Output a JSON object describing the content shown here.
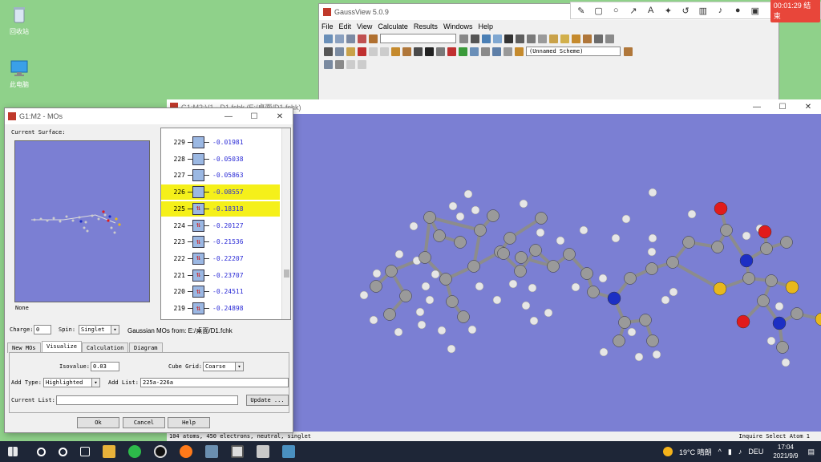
{
  "desktop": {
    "icons": [
      {
        "name": "recycle-bin",
        "label": "回收站"
      },
      {
        "name": "this-pc",
        "label": "此电脑"
      }
    ]
  },
  "recorder": {
    "timer": "00:01:29 结束"
  },
  "gaussview": {
    "title": "GaussView 5.0.9",
    "menu": [
      "File",
      "Edit",
      "View",
      "Calculate",
      "Results",
      "Windows",
      "Help"
    ],
    "scheme": "(Unnamed Scheme)"
  },
  "molecule_window": {
    "title": "G1:M2:V1 - D1.fchk (E:/桌面/D1.fchk)",
    "status_left": "104 atoms, 450 electrons, neutral, singlet",
    "status_right": "Inquire Select Atom 1"
  },
  "mos_dialog": {
    "title": "G1:M2 - MOs",
    "current_surface_label": "Current Surface:",
    "none_label": "None",
    "orbitals": [
      {
        "num": "229",
        "value": "-0.01981",
        "occupied": false,
        "highlight": false
      },
      {
        "num": "228",
        "value": "-0.05038",
        "occupied": false,
        "highlight": false
      },
      {
        "num": "227",
        "value": "-0.05863",
        "occupied": false,
        "highlight": false
      },
      {
        "num": "226",
        "value": "-0.08557",
        "occupied": false,
        "highlight": true
      },
      {
        "num": "225",
        "value": "-0.18318",
        "occupied": true,
        "highlight": true
      },
      {
        "num": "224",
        "value": "-0.20127",
        "occupied": true,
        "highlight": false
      },
      {
        "num": "223",
        "value": "-0.21536",
        "occupied": true,
        "highlight": false
      },
      {
        "num": "222",
        "value": "-0.22207",
        "occupied": true,
        "highlight": false
      },
      {
        "num": "221",
        "value": "-0.23707",
        "occupied": true,
        "highlight": false
      },
      {
        "num": "220",
        "value": "-0.24511",
        "occupied": true,
        "highlight": false
      },
      {
        "num": "219",
        "value": "-0.24898",
        "occupied": true,
        "highlight": false
      }
    ],
    "charge_label": "Charge:",
    "charge_value": "0",
    "spin_label": "Spin:",
    "spin_value": "Singlet",
    "mos_from": "Gaussian MOs from:  E:/桌面/D1.fchk",
    "tabs": [
      "New MOs",
      "Visualize",
      "Calculation",
      "Diagram"
    ],
    "active_tab": "Visualize",
    "isovalue_label": "Isovalue:",
    "isovalue": "0.03",
    "cube_grid_label": "Cube Grid:",
    "cube_grid": "Coarse",
    "add_type_label": "Add Type:",
    "add_type": "Highlighted",
    "add_list_label": "Add List:",
    "add_list": "225a-226a",
    "current_list_label": "Current List:",
    "current_list": "",
    "update_label": "Update ...",
    "ok_label": "Ok",
    "cancel_label": "Cancel",
    "help_label": "Help"
  },
  "taskbar": {
    "weather": "19°C 晴朗",
    "lang": "DEU",
    "time": "17:04",
    "date": "2021/9/9"
  },
  "colors": {
    "viewport": "#7b7fd3",
    "highlight": "#f5f01a",
    "carbon": "#9a9a9a",
    "hydrogen": "#e6e6e6",
    "nitrogen": "#1c2fc4",
    "oxygen": "#e11b1b",
    "sulfur": "#e8b81c"
  }
}
